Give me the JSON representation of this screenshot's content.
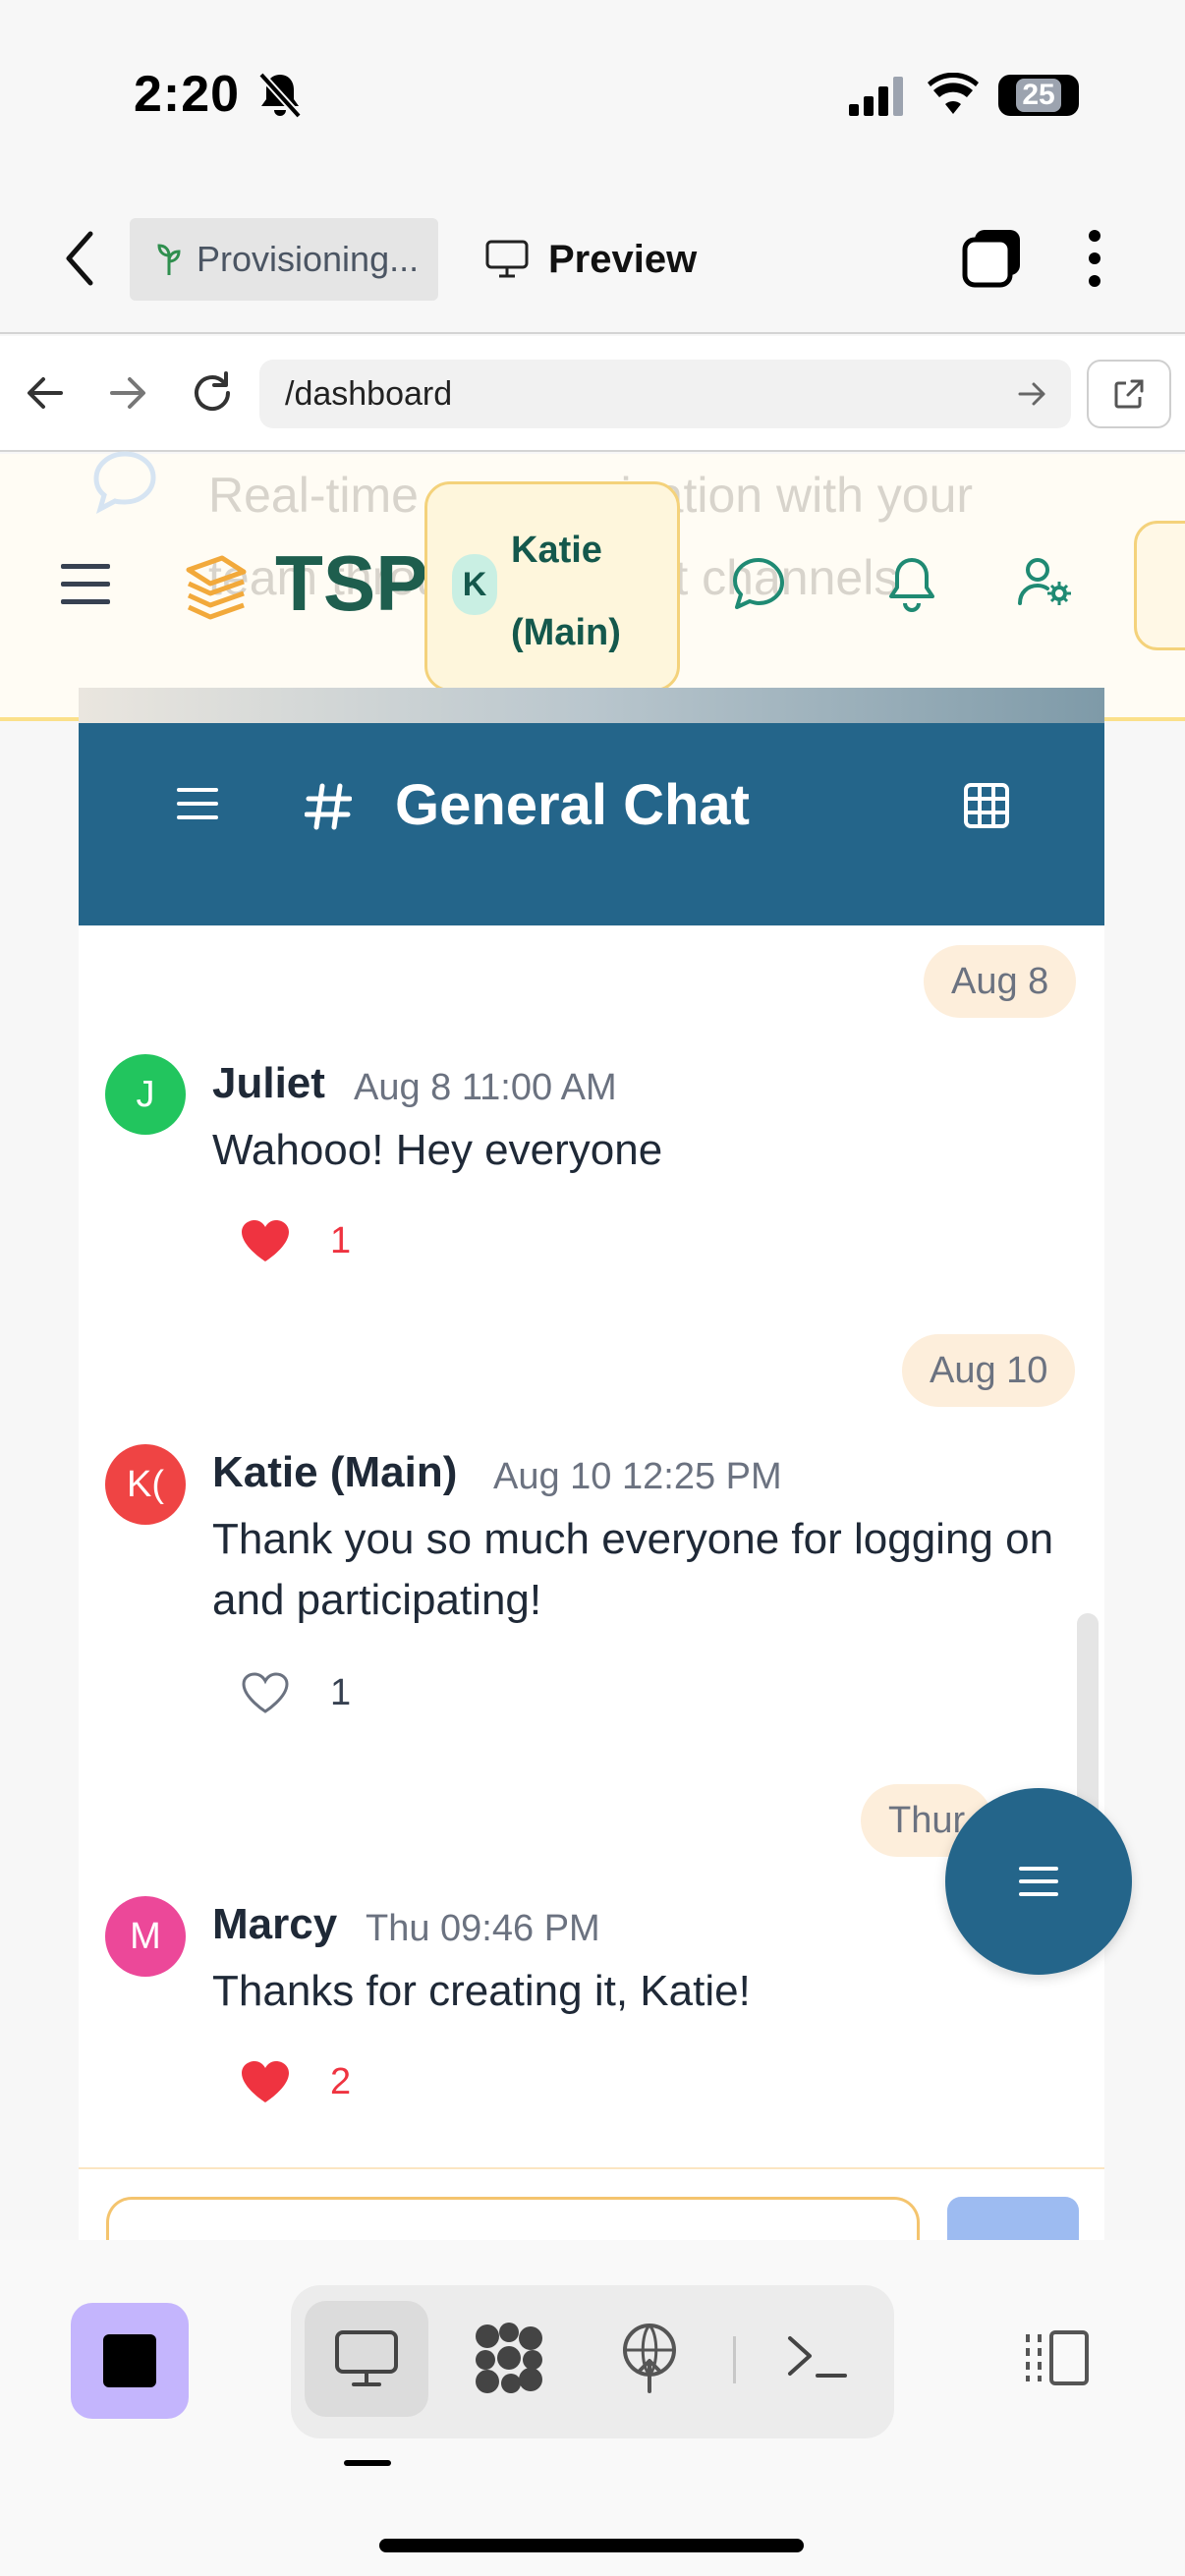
{
  "status_bar": {
    "time": "2:20",
    "battery": "25"
  },
  "browser": {
    "tabs": [
      {
        "label": "Provisioning..."
      },
      {
        "label": "Preview"
      }
    ],
    "url": "/dashboard"
  },
  "app_header": {
    "logo_text": "TSP",
    "background_text": "Real-time communication with your team through different channels",
    "user": {
      "initial": "K",
      "name": "Katie (Main)"
    }
  },
  "channel": {
    "title": "General Chat"
  },
  "messages": [
    {
      "date_divider": "Aug 8",
      "author": "Juliet",
      "initials": "J",
      "avatar_color": "#22c55e",
      "timestamp": "Aug 8 11:00 AM",
      "text": "Wahooo! Hey everyone",
      "reaction_count": "1",
      "liked": true
    },
    {
      "date_divider": "Aug 10",
      "author": "Katie (Main)",
      "initials": "K(",
      "avatar_color": "#ef4444",
      "timestamp": "Aug 10 12:25 PM",
      "text": "Thank you so much everyone for logging on and participating!",
      "reaction_count": "1",
      "liked": false
    },
    {
      "date_divider": "Thur",
      "author": "Marcy",
      "initials": "M",
      "avatar_color": "#ec4899",
      "timestamp": "Thu 09:46 PM",
      "text": "Thanks for creating it, Katie!",
      "reaction_count": "2",
      "liked": true
    }
  ],
  "colors": {
    "accent": "#24658a",
    "like_red": "#ef3340",
    "brand_green": "#1e5e4e",
    "highlight_yellow": "#fbe08a"
  }
}
